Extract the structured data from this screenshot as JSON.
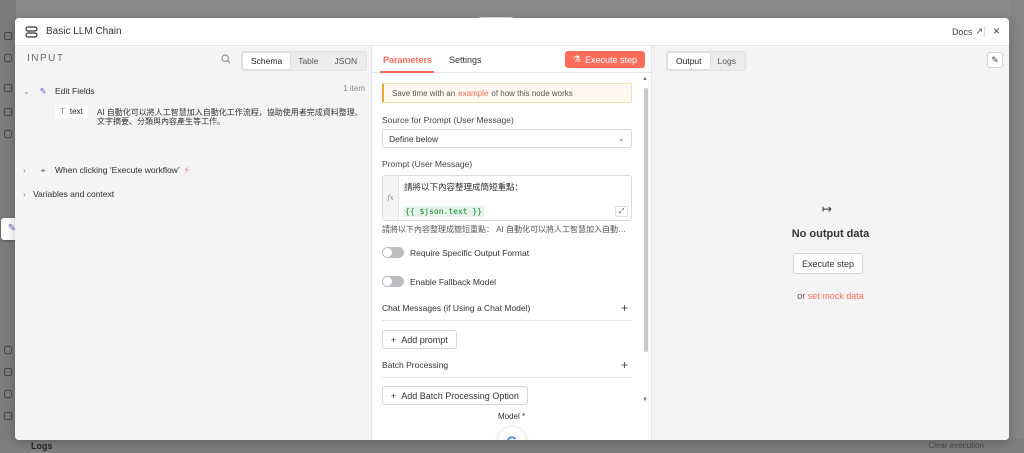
{
  "modal": {
    "title": "Basic LLM Chain",
    "docs_label": "Docs",
    "close_glyph": "×"
  },
  "input_panel": {
    "heading": "INPUT",
    "view_tabs": [
      "Schema",
      "Table",
      "JSON"
    ],
    "active_tab": "Schema",
    "tree": {
      "edit_fields_label": "Edit Fields",
      "edit_fields_count": "1 item",
      "field_type_glyph": "T",
      "field_name": "text",
      "field_value": "AI 自動化可以將人工智慧加入自動化工作流程，協助使用者完成資料整理、文字摘要、分類與內容產生等工作。",
      "trigger_label": "When clicking ‘Execute workflow’",
      "variables_label": "Variables and context"
    }
  },
  "params_panel": {
    "tabs": [
      "Parameters",
      "Settings"
    ],
    "execute_label": "Execute step",
    "tip_prefix": "Save time with an",
    "tip_link": "example",
    "tip_suffix": "of how this node works",
    "source_label": "Source for Prompt (User Message)",
    "source_value": "Define below",
    "prompt_label": "Prompt (User Message)",
    "prompt_line1": "請將以下內容整理成簡短重點：",
    "prompt_expr": "{{ $json.text }}",
    "prompt_preview": "請將以下內容整理成簡短重點： AI 自動化可以將人工智慧加入自動化工作流程，協助使用者完成資料整理、文字摘要、分類與內容產生等工作。",
    "toggle_output_format": "Require Specific Output Format",
    "toggle_fallback": "Enable Fallback Model",
    "chat_messages_label": "Chat Messages (if Using a Chat Model)",
    "add_prompt_label": "Add prompt",
    "batch_label": "Batch Processing",
    "add_batch_label": "Add Batch Processing Option",
    "model_label": "Model *",
    "model_logo_glyph": "G"
  },
  "output_panel": {
    "tabs": [
      "Output",
      "Logs"
    ],
    "active_tab": "Output",
    "empty_title": "No output data",
    "execute_label": "Execute step",
    "mock_prefix": "or",
    "mock_link": "set mock data"
  },
  "background": {
    "logs_label": "Logs",
    "clear_label": "Clear execution"
  },
  "colors": {
    "accent": "#ff6d5a",
    "panel_bg": "#f4f4f5"
  }
}
